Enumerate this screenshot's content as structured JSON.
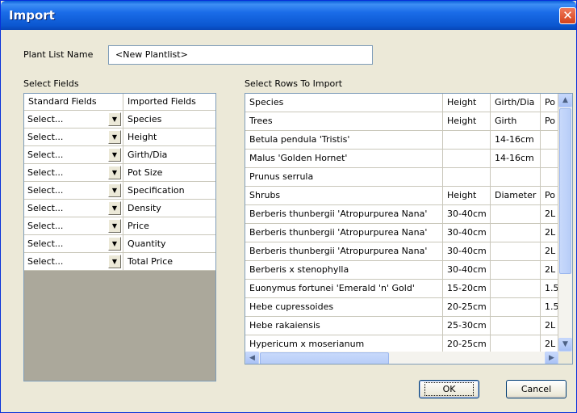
{
  "window": {
    "title": "Import",
    "close_label": "✕"
  },
  "plant_list": {
    "label": "Plant List Name",
    "value": "<New Plantlist>"
  },
  "select_fields": {
    "label": "Select Fields",
    "headers": [
      "Standard Fields",
      "Imported Fields"
    ],
    "rows": [
      {
        "standard": "Select...",
        "imported": "Species"
      },
      {
        "standard": "Select...",
        "imported": "Height"
      },
      {
        "standard": "Select...",
        "imported": "Girth/Dia"
      },
      {
        "standard": "Select...",
        "imported": "Pot Size"
      },
      {
        "standard": "Select...",
        "imported": "Specification"
      },
      {
        "standard": "Select...",
        "imported": "Density"
      },
      {
        "standard": "Select...",
        "imported": "Price"
      },
      {
        "standard": "Select...",
        "imported": "Quantity"
      },
      {
        "standard": "Select...",
        "imported": "Total Price"
      }
    ]
  },
  "select_rows": {
    "label": "Select Rows To Import",
    "headers": [
      "Species",
      "Height",
      "Girth/Dia",
      "Po"
    ],
    "rows": [
      [
        "Trees",
        "Height",
        "Girth",
        "Po"
      ],
      [
        "Betula pendula 'Tristis'",
        "",
        "14-16cm",
        ""
      ],
      [
        "Malus 'Golden Hornet'",
        "",
        "14-16cm",
        ""
      ],
      [
        "Prunus serrula",
        "",
        "",
        ""
      ],
      [
        "Shrubs",
        "Height",
        "Diameter",
        "Po"
      ],
      [
        "Berberis thunbergii 'Atropurpurea Nana'",
        "30-40cm",
        "",
        "2L"
      ],
      [
        "Berberis thunbergii 'Atropurpurea Nana'",
        "30-40cm",
        "",
        "2L"
      ],
      [
        "Berberis thunbergii 'Atropurpurea Nana'",
        "30-40cm",
        "",
        "2L"
      ],
      [
        "Berberis x stenophylla",
        "30-40cm",
        "",
        "2L"
      ],
      [
        "Euonymus fortunei 'Emerald 'n' Gold'",
        "15-20cm",
        "",
        "1.5"
      ],
      [
        "Hebe cupressoides",
        "20-25cm",
        "",
        "1.5"
      ],
      [
        "Hebe rakaiensis",
        "25-30cm",
        "",
        "2L"
      ],
      [
        "Hypericum x moserianum",
        "20-25cm",
        "",
        "2L"
      ]
    ]
  },
  "scroll": {
    "up": "▲",
    "down": "▼",
    "left": "◀",
    "right": "▶"
  },
  "buttons": {
    "ok": "OK",
    "cancel": "Cancel"
  },
  "colors": {
    "titlebar": "#0b57d0",
    "dialog_bg": "#ece9d8",
    "grid_border": "#7f9db9"
  }
}
